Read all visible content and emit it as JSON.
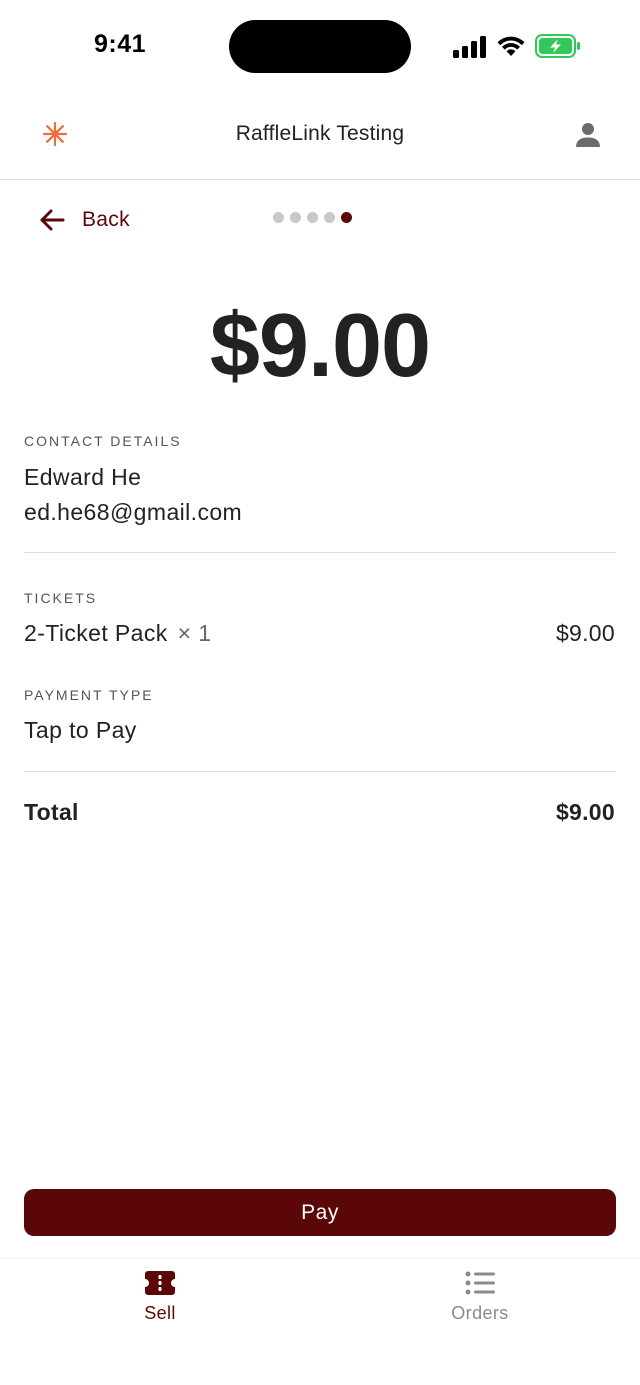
{
  "status_bar": {
    "time": "9:41"
  },
  "header": {
    "title": "RaffleLink Testing",
    "logo_icon": "asterisk-icon",
    "account_icon": "person-icon"
  },
  "navigation": {
    "back_label": "Back",
    "steps_total": 5,
    "current_step": 5
  },
  "summary": {
    "amount": "$9.00",
    "contact": {
      "label": "CONTACT DETAILS",
      "name": "Edward He",
      "email": "ed.he68@gmail.com"
    },
    "tickets": {
      "label": "TICKETS",
      "item_name": "2-Ticket Pack",
      "quantity": "× 1",
      "item_price": "$9.00"
    },
    "payment": {
      "label": "PAYMENT TYPE",
      "value": "Tap to Pay"
    },
    "total": {
      "label": "Total",
      "value": "$9.00"
    }
  },
  "actions": {
    "pay_label": "Pay"
  },
  "bottom_nav": {
    "items": [
      {
        "label": "Sell",
        "icon": "ticket-icon",
        "active": true
      },
      {
        "label": "Orders",
        "icon": "list-icon",
        "active": false
      }
    ]
  },
  "colors": {
    "brand": "#5c0707",
    "logo_accent": "#f06a3b",
    "inactive": "#8a8a8a",
    "battery_green": "#34c759"
  }
}
